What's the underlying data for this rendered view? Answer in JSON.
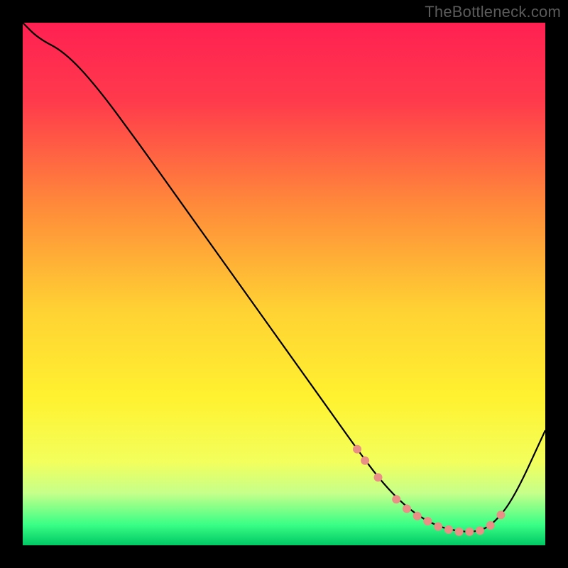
{
  "watermark": "TheBottleneck.com",
  "chart_data": {
    "type": "line",
    "title": "",
    "xlabel": "",
    "ylabel": "",
    "xlim": [
      0,
      100
    ],
    "ylim": [
      0,
      100
    ],
    "background_gradient": {
      "stops": [
        {
          "offset": 0.0,
          "color": "#ff2052"
        },
        {
          "offset": 0.15,
          "color": "#ff3a4c"
        },
        {
          "offset": 0.35,
          "color": "#ff8a3a"
        },
        {
          "offset": 0.55,
          "color": "#ffd233"
        },
        {
          "offset": 0.72,
          "color": "#fff230"
        },
        {
          "offset": 0.84,
          "color": "#f3ff5c"
        },
        {
          "offset": 0.9,
          "color": "#c6ff8a"
        },
        {
          "offset": 0.96,
          "color": "#3bff86"
        },
        {
          "offset": 1.0,
          "color": "#00c864"
        }
      ]
    },
    "series": [
      {
        "name": "bottleneck-curve",
        "color": "#000000",
        "x": [
          0.0,
          3.0,
          8.0,
          14.0,
          22.0,
          30.0,
          38.0,
          46.0,
          54.0,
          60.0,
          64.0,
          68.0,
          72.0,
          76.0,
          80.0,
          84.0,
          87.0,
          90.0,
          94.0,
          100.0
        ],
        "y": [
          100.0,
          97.0,
          94.4,
          88.0,
          77.2,
          66.0,
          54.8,
          43.6,
          32.4,
          24.0,
          18.4,
          13.0,
          8.6,
          5.4,
          3.4,
          2.6,
          2.6,
          4.0,
          9.0,
          22.0
        ]
      }
    ],
    "markers": {
      "name": "highlight-dots",
      "color": "#e98f86",
      "radius": 6,
      "points": [
        {
          "x": 64.0,
          "y": 18.4
        },
        {
          "x": 65.5,
          "y": 16.2
        },
        {
          "x": 68.0,
          "y": 13.0
        },
        {
          "x": 71.5,
          "y": 8.8
        },
        {
          "x": 73.5,
          "y": 7.0
        },
        {
          "x": 75.5,
          "y": 5.6
        },
        {
          "x": 77.5,
          "y": 4.6
        },
        {
          "x": 79.5,
          "y": 3.6
        },
        {
          "x": 81.5,
          "y": 3.0
        },
        {
          "x": 83.5,
          "y": 2.6
        },
        {
          "x": 85.5,
          "y": 2.6
        },
        {
          "x": 87.5,
          "y": 2.8
        },
        {
          "x": 89.5,
          "y": 3.8
        },
        {
          "x": 91.5,
          "y": 5.8
        }
      ]
    }
  }
}
